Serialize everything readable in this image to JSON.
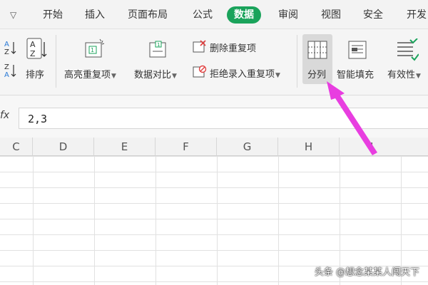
{
  "menu": {
    "arrow": "▽",
    "tabs": [
      "开始",
      "插入",
      "页面布局",
      "公式",
      "数据",
      "审阅",
      "视图",
      "安全",
      "开发"
    ],
    "active": "数据"
  },
  "ribbon": {
    "sort_label": "排序",
    "highlight_dup_label": "高亮重复项",
    "data_compare_label": "数据对比",
    "delete_dup_label": "删除重复项",
    "reject_dup_label": "拒绝录入重复项",
    "split_label": "分列",
    "smart_fill_label": "智能填充",
    "validity_label": "有效性"
  },
  "formula": {
    "fx": "fx",
    "value": "2,3"
  },
  "columns": [
    "C",
    "D",
    "E",
    "F",
    "G",
    "H",
    "I"
  ],
  "watermark": "头条 @想念某某人闯天下",
  "colors": {
    "accent": "#1aa35b",
    "arrow": "#e83ee0"
  }
}
